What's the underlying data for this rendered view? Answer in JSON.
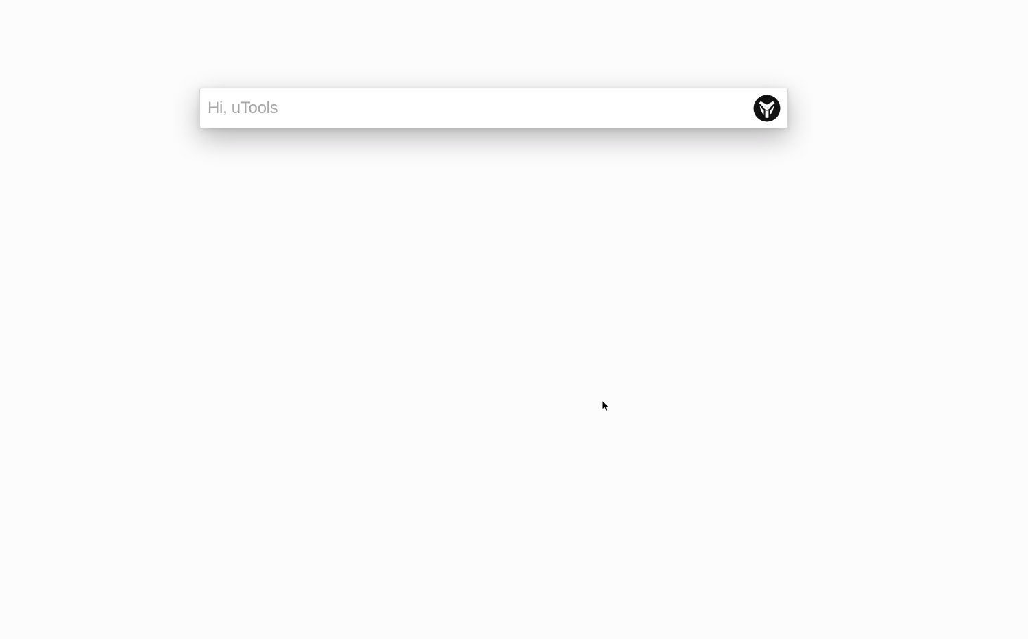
{
  "search": {
    "placeholder": "Hi, uTools",
    "value": ""
  },
  "logo": {
    "icon": "utools-logo-icon",
    "color": "#111111"
  },
  "pointer": {
    "icon": "mouse-pointer-icon"
  },
  "colors": {
    "background": "#fdfcfd",
    "bar_background": "#ffffff",
    "placeholder": "#a6a6a6"
  }
}
